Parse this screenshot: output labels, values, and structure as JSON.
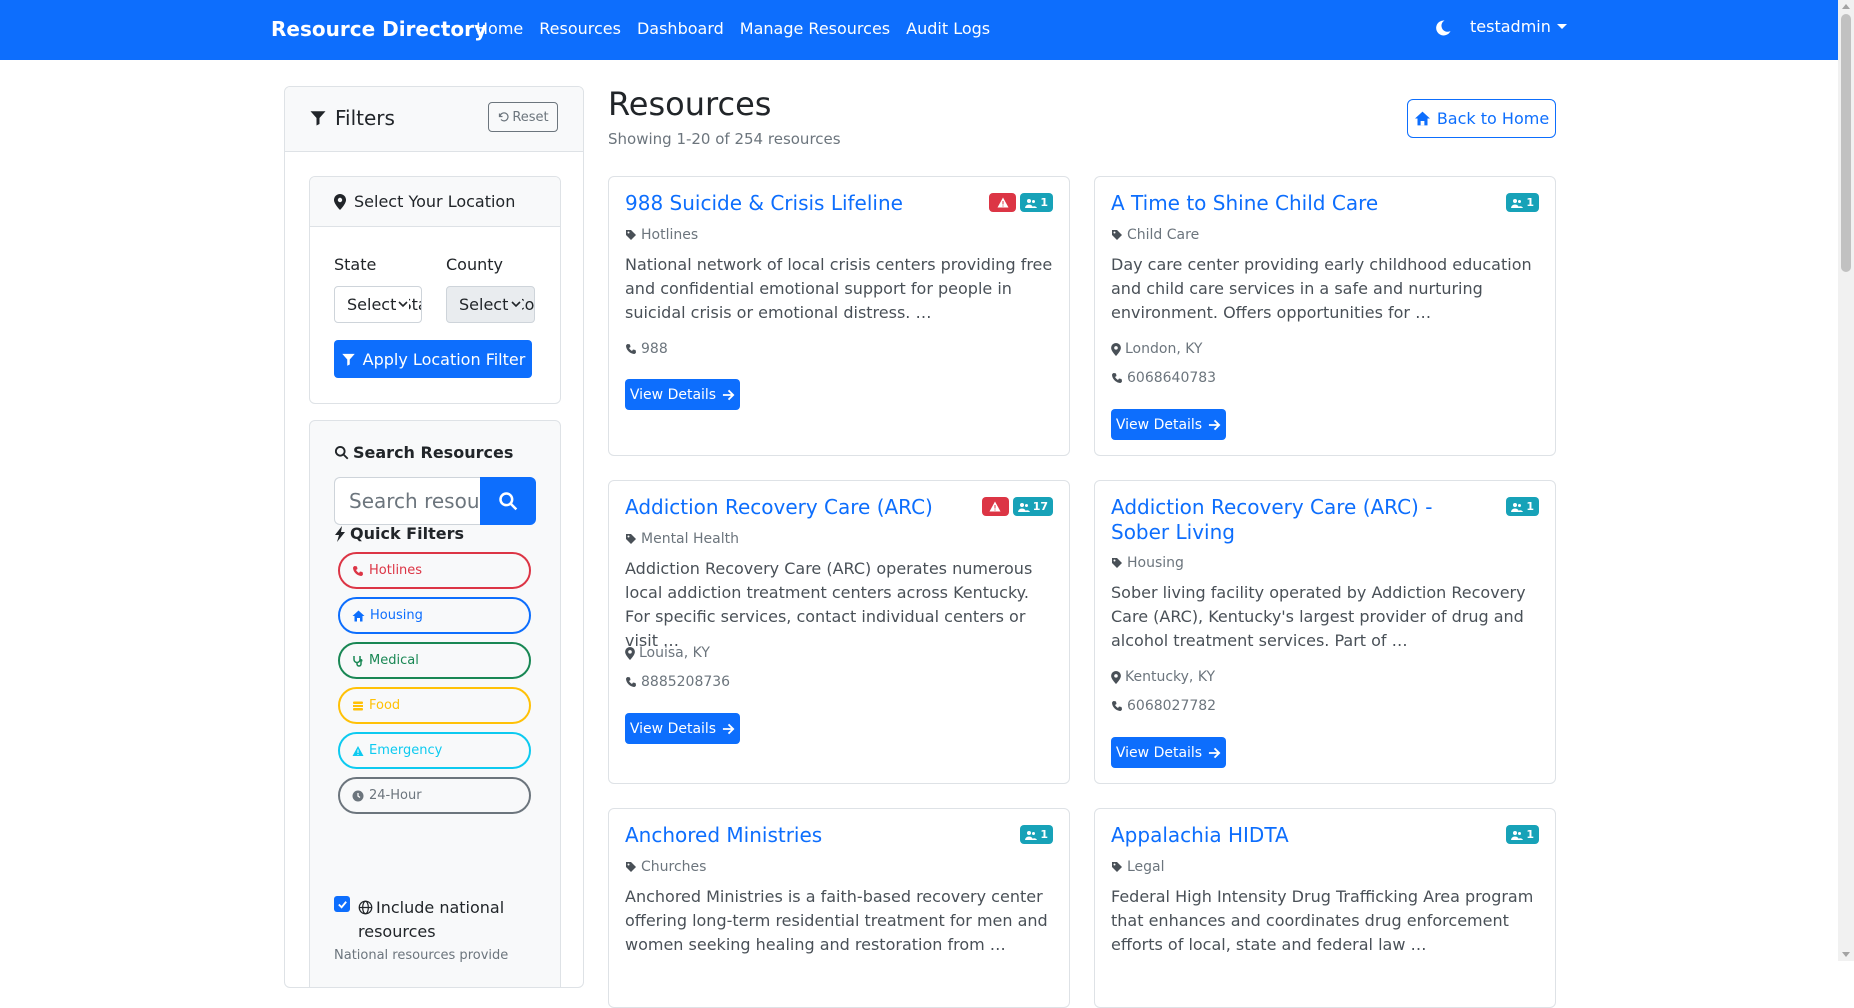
{
  "navbar": {
    "brand": "Resource Directory",
    "links": [
      "Home",
      "Resources",
      "Dashboard",
      "Manage Resources",
      "Audit Logs"
    ],
    "user": "testadmin",
    "theme_icon": "moon-icon"
  },
  "filters": {
    "title": "Filters",
    "reset_label": "Reset",
    "location": {
      "title": "Select Your Location",
      "state_label": "State",
      "state_value": "Select State",
      "county_label": "County",
      "county_value": "Select County",
      "apply_label": "Apply Location Filter"
    },
    "search": {
      "title": "Search Resources",
      "placeholder": "Search resources..."
    },
    "quick": {
      "title": "Quick Filters",
      "items": [
        {
          "label": "Hotlines",
          "icon": "phone-icon",
          "color": "#dc3545"
        },
        {
          "label": "Housing",
          "icon": "home-icon",
          "color": "#0d6efd"
        },
        {
          "label": "Medical",
          "icon": "stethoscope-icon",
          "color": "#198754"
        },
        {
          "label": "Food",
          "icon": "utensils-icon",
          "color": "#ffc107"
        },
        {
          "label": "Emergency",
          "icon": "warning-icon",
          "color": "#0dcaf0"
        },
        {
          "label": "24-Hour",
          "icon": "clock-icon",
          "color": "#6c757d"
        }
      ]
    },
    "national_label": "Include national resources",
    "national_checked": true,
    "national_note": "National resources provide"
  },
  "main": {
    "title": "Resources",
    "subtitle": "Showing 1-20 of 254 resources",
    "back_label": "Back to Home",
    "details_label": "View Details"
  },
  "resources": [
    {
      "title": "988 Suicide & Crisis Lifeline",
      "category": "Hotlines",
      "description": "National network of local crisis centers providing free and confidential emotional support for people in suicidal crisis or emotional distress. …",
      "location": "",
      "phone": "988",
      "alert": true,
      "count": "1"
    },
    {
      "title": "A Time to Shine Child Care",
      "category": "Child Care",
      "description": "Day care center providing early childhood education and child care services in a safe and nurturing environment. Offers opportunities for …",
      "location": "London, KY",
      "phone": "6068640783",
      "alert": false,
      "count": "1"
    },
    {
      "title": "Addiction Recovery Care (ARC)",
      "category": "Mental Health",
      "description": "Addiction Recovery Care (ARC) operates numerous local addiction treatment centers across Kentucky. For specific services, contact individual centers or visit …",
      "location": "Louisa, KY",
      "phone": "8885208736",
      "alert": true,
      "count": "17"
    },
    {
      "title": "Addiction Recovery Care (ARC) - Sober Living",
      "category": "Housing",
      "description": "Sober living facility operated by Addiction Recovery Care (ARC), Kentucky's largest provider of drug and alcohol treatment services. Part of …",
      "location": "Kentucky, KY",
      "phone": "6068027782",
      "alert": false,
      "count": "1"
    },
    {
      "title": "Anchored Ministries",
      "category": "Churches",
      "description": "Anchored Ministries is a faith-based recovery center offering long-term residential treatment for men and women seeking healing and restoration from …",
      "location": "",
      "phone": "",
      "alert": false,
      "count": "1"
    },
    {
      "title": "Appalachia HIDTA",
      "category": "Legal",
      "description": "Federal High Intensity Drug Trafficking Area program that enhances and coordinates drug enforcement efforts of local, state and federal law …",
      "location": "",
      "phone": "",
      "alert": false,
      "count": "1"
    }
  ]
}
